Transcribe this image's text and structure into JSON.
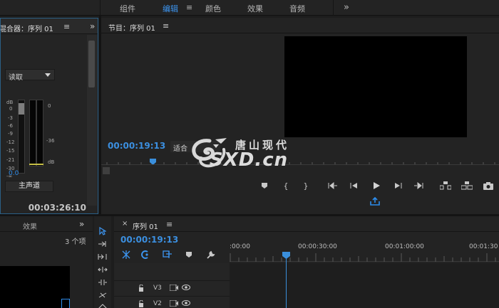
{
  "workspace_tabs": [
    {
      "label": "组件",
      "active": false
    },
    {
      "label": "编辑",
      "active": true
    },
    {
      "label": "颜色",
      "active": false
    },
    {
      "label": "效果",
      "active": false
    },
    {
      "label": "音频",
      "active": false
    }
  ],
  "topbar_menu_icon": "≡",
  "topbar_more_icon": "»",
  "audio_mixer": {
    "title": "混合器：序列 01",
    "menu_icon": "≡",
    "more_icon": "»",
    "mode": "读取",
    "scale_left": [
      "dB",
      "0",
      "-3",
      "-6",
      "-9",
      "-12",
      "-15",
      "-21",
      "-30",
      "-∞"
    ],
    "scale_right": [
      "0",
      "-36",
      "dB"
    ],
    "value": "0.0",
    "master_label": "主声道",
    "timecode": "00:03:26:10"
  },
  "program_monitor": {
    "title": "节目：序列 01",
    "menu_icon": "≡",
    "timecode": "00:00:19:13",
    "fit_label": "适合"
  },
  "logo": {
    "top_text": "唐山现代",
    "bottom_text": "SXD.cn"
  },
  "project_panel": {
    "tab_label": "效果",
    "more_icon": "»",
    "item_count": "3 个项"
  },
  "timeline": {
    "close_icon": "×",
    "title": "序列 01",
    "menu_icon": "≡",
    "timecode": "00:00:19:13",
    "ruler_labels": [
      ":00:00",
      "00:00:30:00",
      "00:01:00:00",
      "00:01:30"
    ],
    "tracks": [
      "V3",
      "V2"
    ]
  },
  "colors": {
    "accent": "#2d8ceb",
    "panel_bg": "#232323",
    "video_bg": "#000000"
  }
}
